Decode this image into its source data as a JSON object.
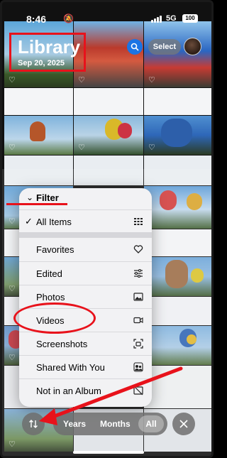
{
  "status": {
    "time": "8:46",
    "network": "5G",
    "battery": "100"
  },
  "header": {
    "title": "Library",
    "date": "Sep 20, 2025",
    "select_label": "Select"
  },
  "menu": {
    "title": "Filter",
    "items": [
      {
        "label": "All Items",
        "checked": true,
        "icon": "grid-icon"
      },
      {
        "label": "Favorites",
        "icon": "heart-icon"
      },
      {
        "label": "Edited",
        "icon": "sliders-icon"
      },
      {
        "label": "Photos",
        "icon": "photo-icon"
      },
      {
        "label": "Videos",
        "icon": "video-icon"
      },
      {
        "label": "Screenshots",
        "icon": "screenshot-icon"
      },
      {
        "label": "Shared With You",
        "icon": "shared-icon"
      },
      {
        "label": "Not in an Album",
        "icon": "no-album-icon"
      }
    ]
  },
  "bottom": {
    "years": "Years",
    "months": "Months",
    "all": "All"
  },
  "colors": {
    "accent_red": "#e8121b",
    "search_blue": "#1b74e4"
  }
}
